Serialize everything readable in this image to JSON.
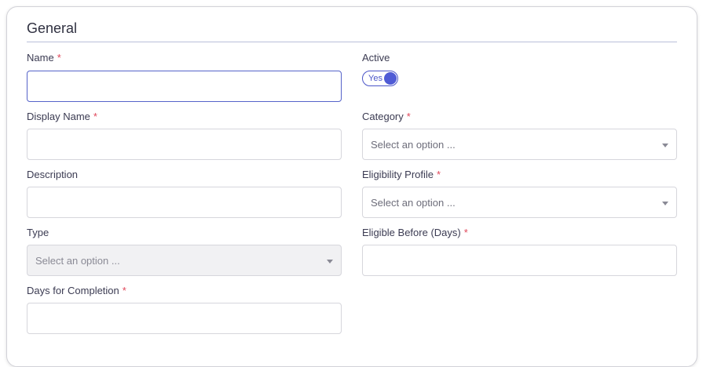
{
  "section": {
    "title": "General"
  },
  "fields": {
    "name": {
      "label": "Name",
      "required": "*",
      "value": ""
    },
    "active": {
      "label": "Active",
      "toggle_text": "Yes",
      "state": true
    },
    "display_name": {
      "label": "Display Name",
      "required": "*",
      "value": ""
    },
    "category": {
      "label": "Category",
      "required": "*",
      "placeholder": "Select an option ..."
    },
    "description": {
      "label": "Description",
      "value": ""
    },
    "eligibility_profile": {
      "label": "Eligibility Profile",
      "required": "*",
      "placeholder": "Select an option ..."
    },
    "type": {
      "label": "Type",
      "placeholder": "Select an option ..."
    },
    "eligible_before": {
      "label": "Eligible Before (Days)",
      "required": "*",
      "value": ""
    },
    "days_for_completion": {
      "label": "Days for Completion",
      "required": "*",
      "value": ""
    }
  },
  "colors": {
    "accent": "#4f5bd5",
    "required": "#e0475a",
    "border": "#d6d6dc"
  }
}
